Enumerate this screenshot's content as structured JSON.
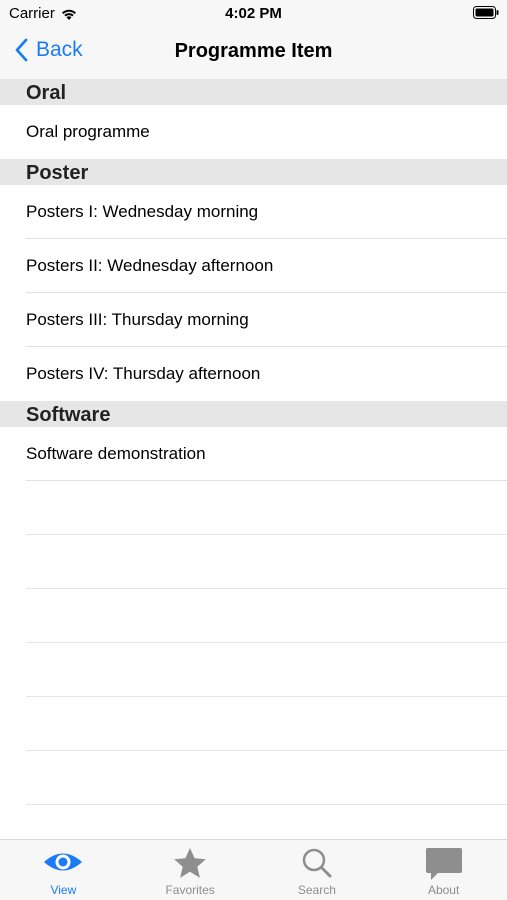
{
  "status_bar": {
    "carrier": "Carrier",
    "time": "4:02 PM"
  },
  "nav": {
    "back_label": "Back",
    "title": "Programme Item"
  },
  "sections": [
    {
      "header": "Oral",
      "items": [
        "Oral programme"
      ]
    },
    {
      "header": "Poster",
      "items": [
        "Posters I: Wednesday morning",
        "Posters II: Wednesday afternoon",
        "Posters III: Thursday morning",
        "Posters IV: Thursday afternoon"
      ]
    },
    {
      "header": "Software",
      "items": [
        "Software demonstration"
      ]
    }
  ],
  "tabs": [
    {
      "label": "View",
      "icon": "eye-icon",
      "active": true
    },
    {
      "label": "Favorites",
      "icon": "star-icon",
      "active": false
    },
    {
      "label": "Search",
      "icon": "magnifier-icon",
      "active": false
    },
    {
      "label": "About",
      "icon": "speech-bubble-icon",
      "active": false
    }
  ],
  "colors": {
    "accent": "#1a7cf5",
    "inactive_tab": "#8e8e8e",
    "section_header_bg": "#e6e6e6"
  }
}
